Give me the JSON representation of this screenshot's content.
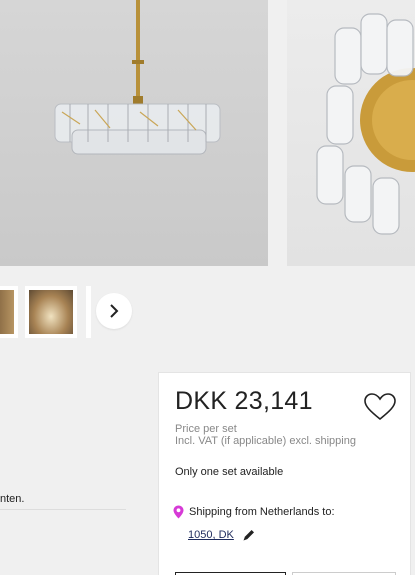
{
  "price_card": {
    "price": "DKK 23,141",
    "price_unit": "Price per set",
    "vat_note": "Incl. VAT (if applicable) excl. shipping",
    "availability": "Only one set available",
    "shipping_label": "Shipping from Netherlands to:",
    "postal_code": "1050, DK"
  },
  "description": {
    "fragment": "nten."
  },
  "icons": {
    "favorite": "heart-icon",
    "location": "location-pin-icon",
    "edit": "pencil-icon",
    "next": "chevron-right-icon"
  },
  "colors": {
    "pin": "#d63ad6",
    "link": "#1d2a5c",
    "brass": "#b8913a"
  }
}
